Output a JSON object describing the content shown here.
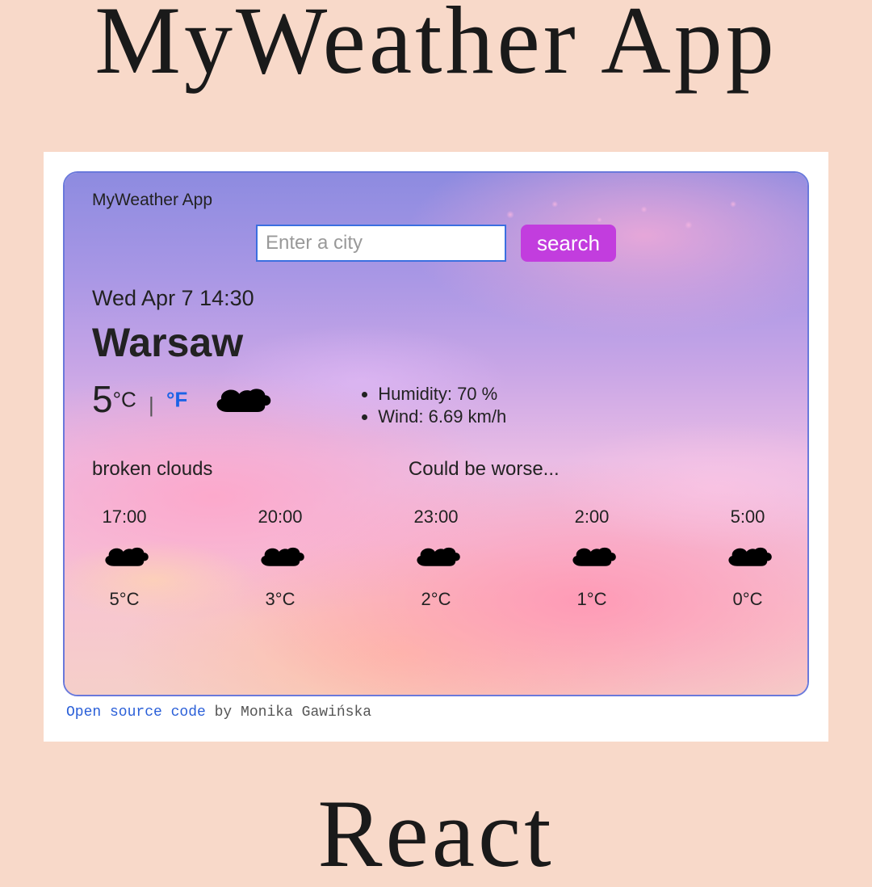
{
  "titles": {
    "top": "MyWeather App",
    "bottom": "React"
  },
  "card": {
    "app_label": "MyWeather App",
    "search": {
      "placeholder": "Enter a city",
      "button_label": "search",
      "value": ""
    },
    "datetime": "Wed Apr 7 14:30",
    "city": "Warsaw",
    "current": {
      "temperature": "5",
      "unit_c": "°C",
      "unit_sep": " | ",
      "unit_f": "°F",
      "icon": "cloud-icon"
    },
    "details": {
      "humidity_label": "Humidity: 70 %",
      "wind_label": "Wind: 6.69 km/h"
    },
    "description": "broken clouds",
    "mood": "Could be worse...",
    "forecast": [
      {
        "time": "17:00",
        "icon": "cloud-icon",
        "temp": "5°C"
      },
      {
        "time": "20:00",
        "icon": "cloud-icon",
        "temp": "3°C"
      },
      {
        "time": "23:00",
        "icon": "cloud-icon",
        "temp": "2°C"
      },
      {
        "time": "2:00",
        "icon": "cloud-icon",
        "temp": "1°C"
      },
      {
        "time": "5:00",
        "icon": "cloud-icon",
        "temp": "0°C"
      }
    ]
  },
  "footer": {
    "link_text": "Open source code",
    "rest": " by Monika Gawińska"
  }
}
